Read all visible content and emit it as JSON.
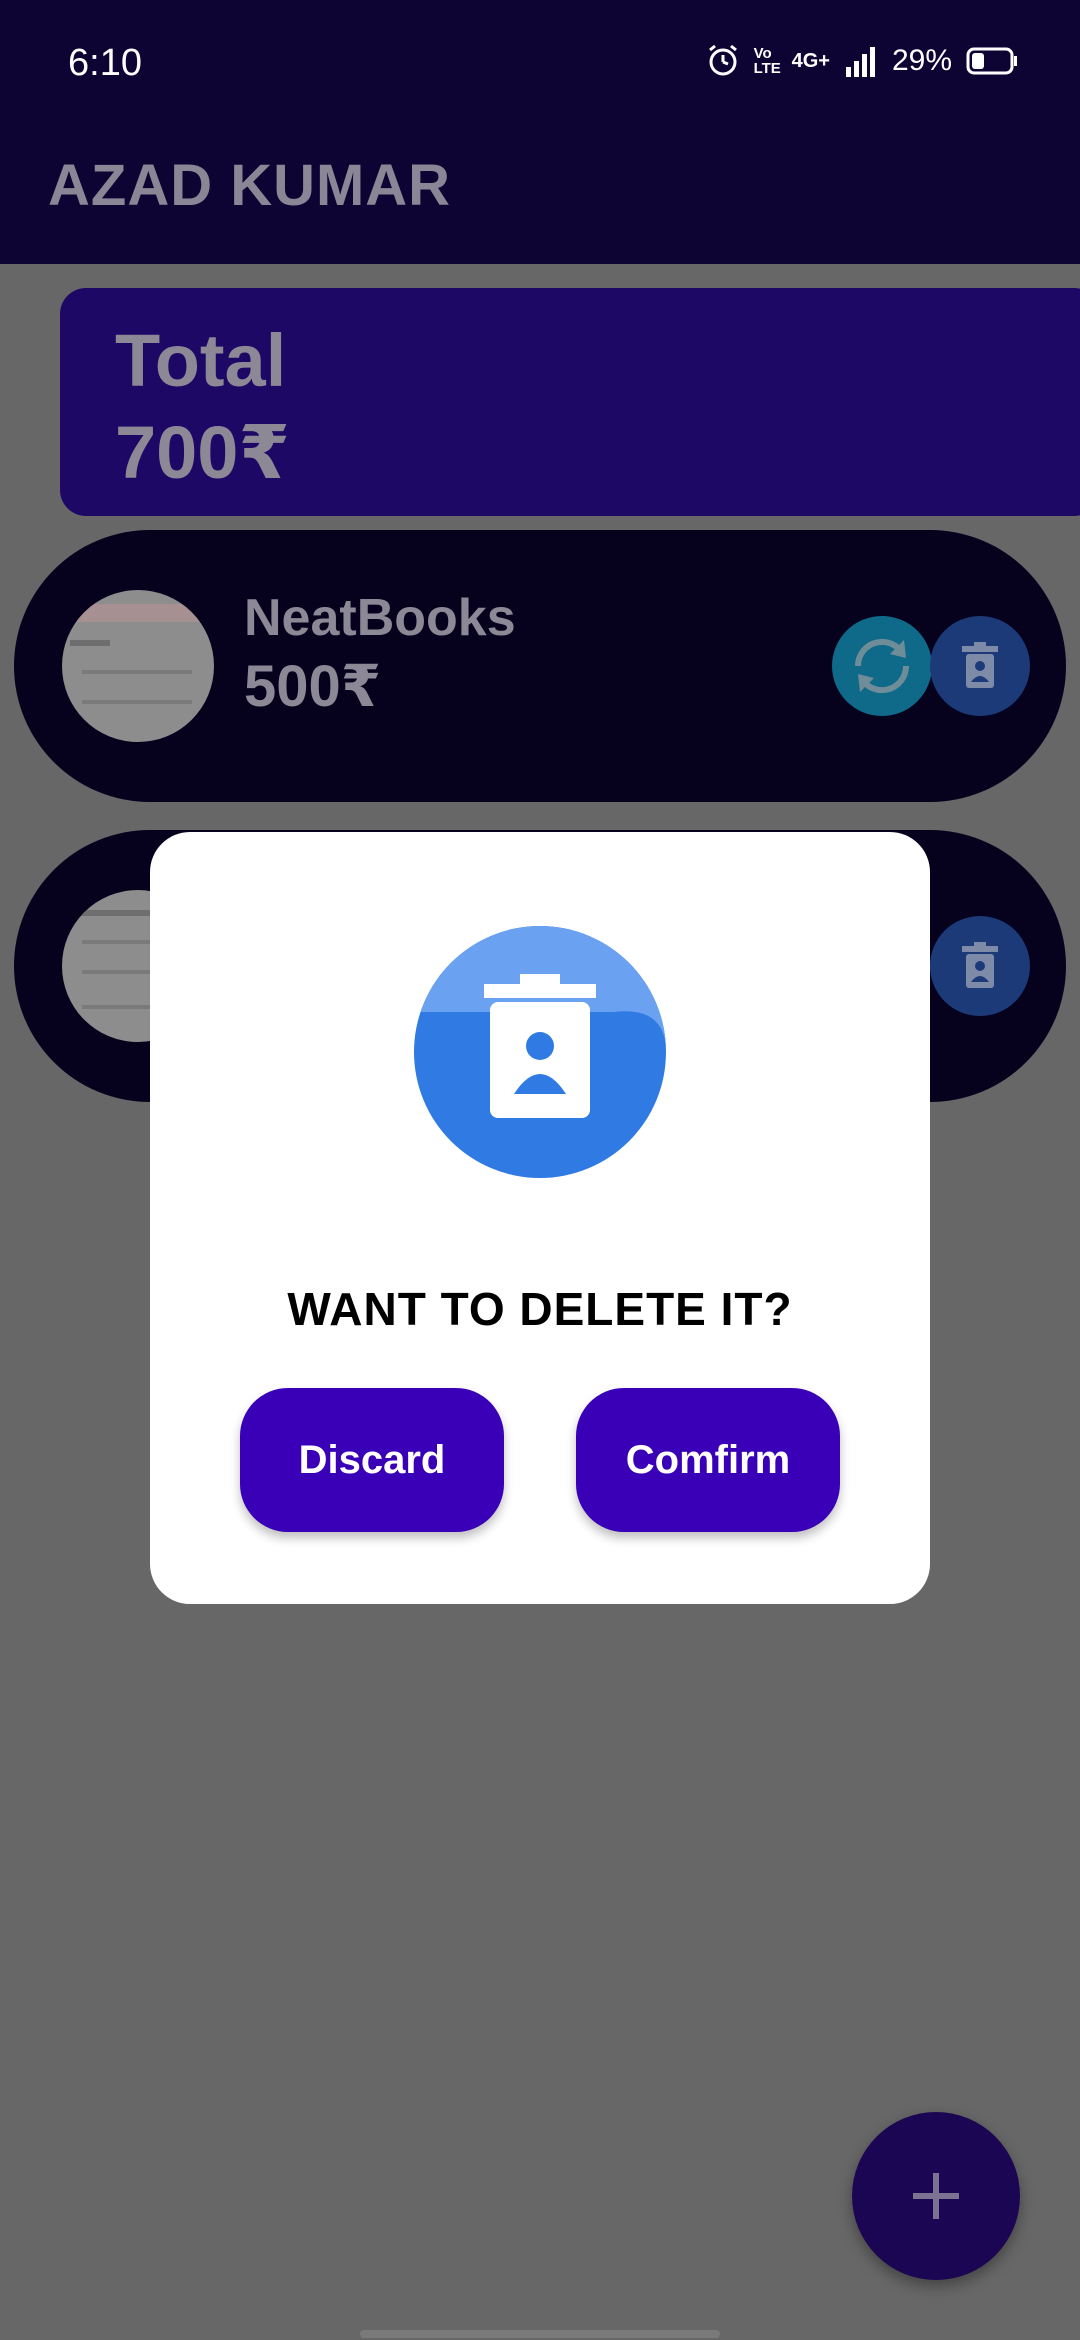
{
  "status_bar": {
    "time": "6:10",
    "network": "4G+",
    "volte": "Vo LTE",
    "battery": "29%",
    "icons": [
      "alarm-icon",
      "volte-icon",
      "signal-icon",
      "battery-icon"
    ]
  },
  "app_bar": {
    "title": "AZAD KUMAR"
  },
  "total_card": {
    "label": "Total",
    "value": "700₹"
  },
  "items": [
    {
      "name": "NeatBooks",
      "amount": "500₹"
    },
    {
      "name": "",
      "amount": ""
    }
  ],
  "dialog": {
    "title": "WANT TO DELETE IT?",
    "discard_label": "Discard",
    "confirm_label": "Comfirm",
    "icon": "delete-contact-icon"
  },
  "fab": {
    "icon": "plus-icon"
  },
  "colors": {
    "app_bar": "#0d0433",
    "card": "#1d0865",
    "list_item": "#06021e",
    "button": "#3a00b8",
    "dialog_icon": "#2f7be3",
    "scrim": "#676767"
  }
}
